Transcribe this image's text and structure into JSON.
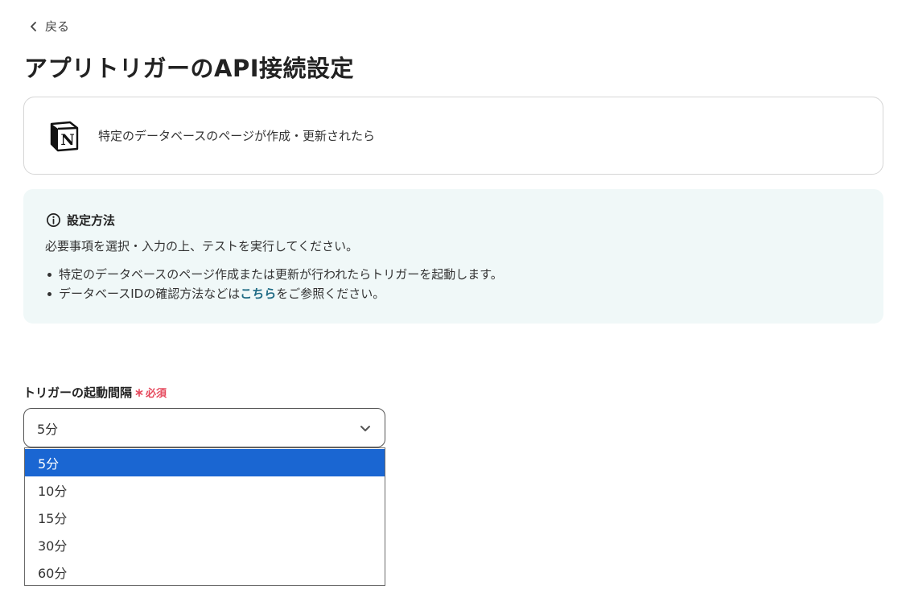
{
  "nav": {
    "back_label": "戻る"
  },
  "page": {
    "title": "アプリトリガーのAPI接続設定"
  },
  "app_card": {
    "app_icon": "notion-logo-icon",
    "trigger_text": "特定のデータベースのページが作成・更新されたら"
  },
  "info": {
    "heading": "設定方法",
    "description": "必要事項を選択・入力の上、テストを実行してください。",
    "bullet1": "特定のデータベースのページ作成または更新が行われたらトリガーを起動します。",
    "bullet2_prefix": "データベースIDの確認方法などは",
    "bullet2_link": "こちら",
    "bullet2_suffix": "をご参照ください。",
    "link_color": "#1e6a84",
    "background_color": "#f0f8f8"
  },
  "trigger_interval": {
    "label": "トリガーの起動間隔",
    "required_label": "必須",
    "required_color": "#e5485c",
    "selected_value": "5分",
    "options": [
      "5分",
      "10分",
      "15分",
      "30分",
      "60分"
    ],
    "highlight_color": "#1a66d2"
  }
}
